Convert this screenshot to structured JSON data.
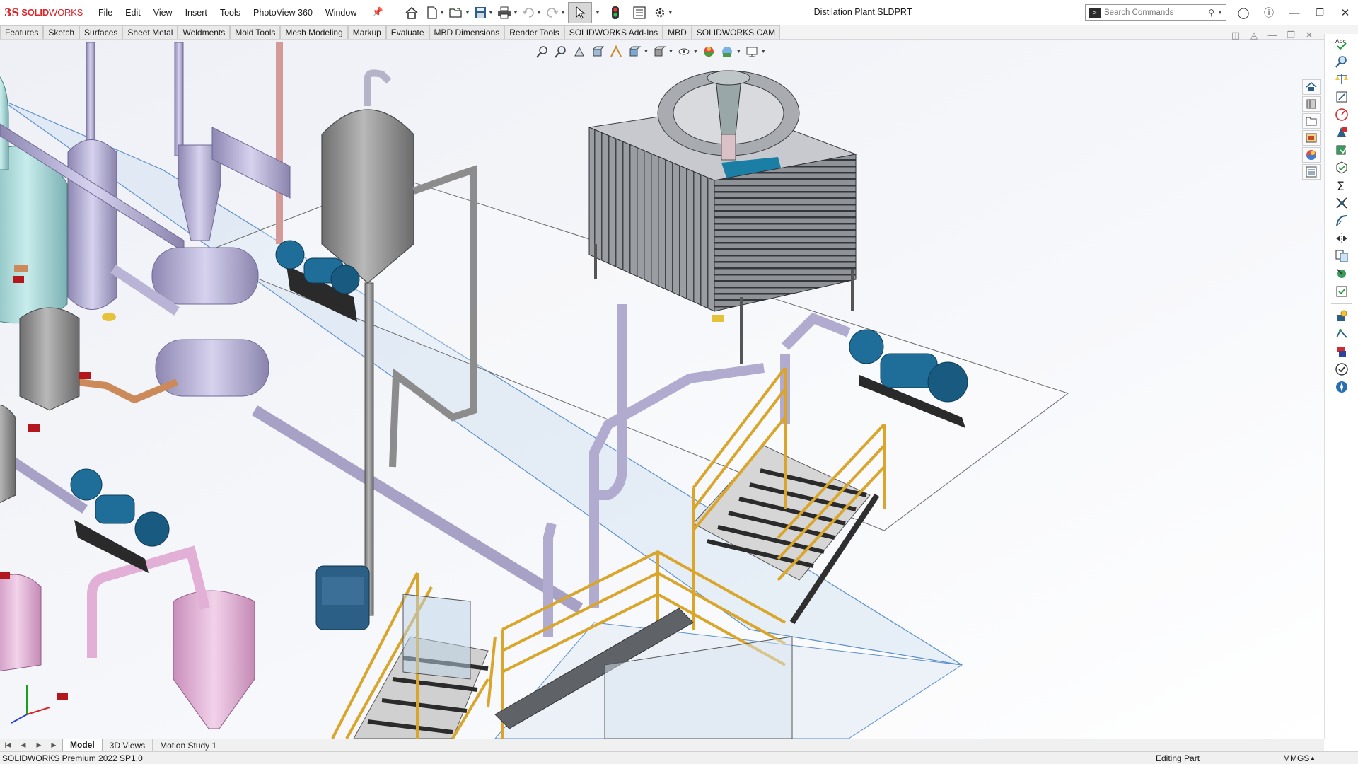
{
  "app": {
    "brand_ds": "3S",
    "brand_solid": "SOLID",
    "brand_works": "WORKS",
    "document_title": "Distilation Plant.SLDPRT"
  },
  "menu": [
    "File",
    "Edit",
    "View",
    "Insert",
    "Tools",
    "PhotoView 360",
    "Window"
  ],
  "quick_access": [
    {
      "name": "home-icon",
      "dropdown": false
    },
    {
      "name": "new-document-icon",
      "dropdown": true
    },
    {
      "name": "open-folder-icon",
      "dropdown": true
    },
    {
      "name": "save-icon",
      "dropdown": true
    },
    {
      "name": "print-icon",
      "dropdown": true
    },
    {
      "name": "undo-icon",
      "dropdown": true
    },
    {
      "name": "redo-icon",
      "dropdown": true
    },
    {
      "name": "select-cursor-icon",
      "dropdown": true
    },
    {
      "name": "traffic-light-icon",
      "dropdown": false
    },
    {
      "name": "file-properties-icon",
      "dropdown": false
    },
    {
      "name": "options-gear-icon",
      "dropdown": true
    }
  ],
  "search": {
    "placeholder": "Search Commands"
  },
  "command_tabs": [
    "Features",
    "Sketch",
    "Surfaces",
    "Sheet Metal",
    "Weldments",
    "Mold Tools",
    "Mesh Modeling",
    "Markup",
    "Evaluate",
    "MBD Dimensions",
    "Render Tools",
    "SOLIDWORKS Add-Ins",
    "MBD",
    "SOLIDWORKS CAM"
  ],
  "bottom_tabs": [
    "Model",
    "3D Views",
    "Motion Study 1"
  ],
  "status": {
    "product": "SOLIDWORKS Premium 2022 SP1.0",
    "mode": "Editing Part",
    "units": "MMGS"
  },
  "colors": {
    "brand_red": "#d8262c",
    "pipe_lavender": "#b9b3d6",
    "tank_gray": "#8e8e8e",
    "railing_gold": "#d9a52a",
    "pump_blue": "#1f6e9a",
    "pink_tank": "#e7b6d8",
    "glass_blue": "#cfdff0",
    "teal_tank": "#9fcfcf"
  }
}
